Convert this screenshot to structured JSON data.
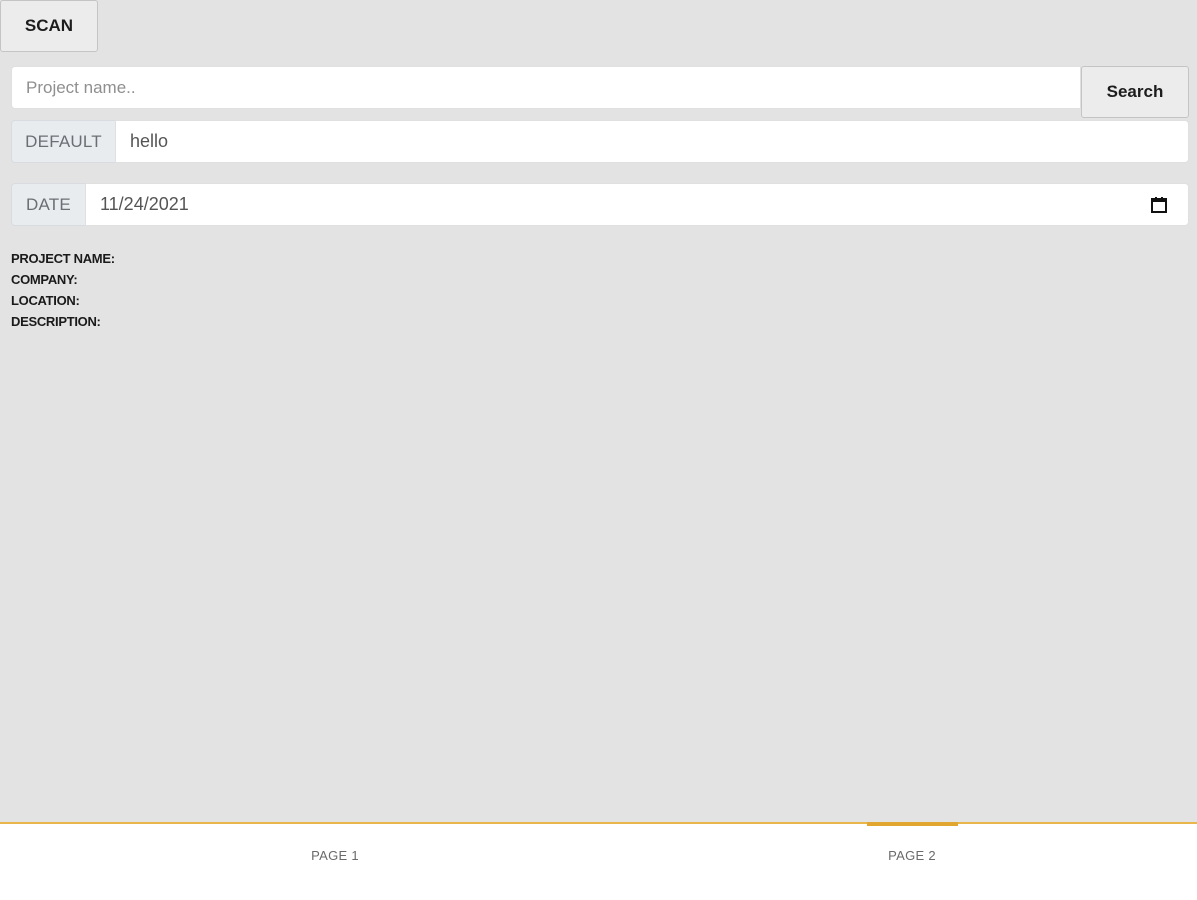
{
  "toolbar": {
    "scan_label": "SCAN"
  },
  "search": {
    "placeholder": "Project name..",
    "value": "",
    "button_label": "Search"
  },
  "default_group": {
    "label": "DEFAULT",
    "value": "hello"
  },
  "date_group": {
    "label": "DATE",
    "value": "11/24/2021"
  },
  "project_info": {
    "project_name_label": "PROJECT NAME:",
    "company_label": "COMPANY:",
    "location_label": "LOCATION:",
    "description_label": "DESCRIPTION:"
  },
  "bottom_nav": {
    "tabs": [
      {
        "label": "PAGE 1"
      },
      {
        "label": "PAGE 2"
      }
    ],
    "active_tab": "PAGE 2",
    "accent_color": "#e0a630"
  },
  "icons": {
    "date_picker": "calendar-icon"
  }
}
